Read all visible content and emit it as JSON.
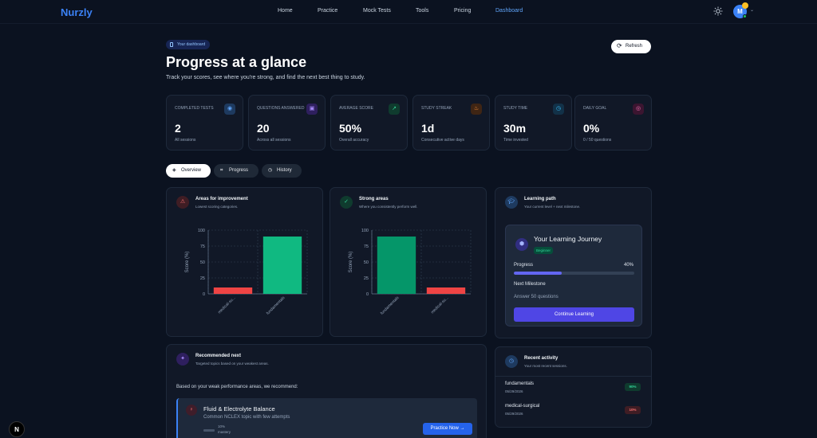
{
  "nav": {
    "logo": "Nurzly",
    "links": [
      "Home",
      "Practice",
      "Mock Tests",
      "Tools",
      "Pricing",
      "Dashboard"
    ],
    "active": "Dashboard",
    "avatar_initial": "M"
  },
  "header": {
    "pill": "Your dashboard",
    "title": "Progress at a glance",
    "subtitle": "Track your scores, see where you're strong, and find the next best thing to study.",
    "refresh_label": "Refresh"
  },
  "stats": [
    {
      "label": "COMPLETED TESTS",
      "value": "2",
      "sub": "All sessions",
      "icon": "eye-icon",
      "color": "#60a5fa",
      "bg": "#1e3a5f"
    },
    {
      "label": "QUESTIONS ANSWERED",
      "value": "20",
      "sub": "Across all sessions",
      "icon": "book-icon",
      "color": "#a78bfa",
      "bg": "#2e1f5e"
    },
    {
      "label": "AVERAGE SCORE",
      "value": "50%",
      "sub": "Overall accuracy",
      "icon": "trend-icon",
      "color": "#34d399",
      "bg": "#0f3b2e"
    },
    {
      "label": "STUDY STREAK",
      "value": "1d",
      "sub": "Consecutive active days",
      "icon": "flame-icon",
      "color": "#fb923c",
      "bg": "#3f2514"
    },
    {
      "label": "STUDY TIME",
      "value": "30m",
      "sub": "Time invested",
      "icon": "clock-icon",
      "color": "#38bdf8",
      "bg": "#123148"
    },
    {
      "label": "DAILY GOAL",
      "value": "0%",
      "sub": "0 / 50 questions",
      "icon": "target-icon",
      "color": "#f472b6",
      "bg": "#3b1530"
    }
  ],
  "tabs": [
    "Overview",
    "Progress",
    "History"
  ],
  "areas_improvement": {
    "title": "Areas for improvement",
    "subtitle": "Lowest scoring categories."
  },
  "strong_areas": {
    "title": "Strong areas",
    "subtitle": "Where you consistently perform well."
  },
  "learning_path": {
    "title": "Learning path",
    "subtitle": "Your current level + next milestone.",
    "journey_title": "Your Learning Journey",
    "badge": "Beginner",
    "progress_label": "Progress",
    "progress_value": "40%",
    "progress_fraction": 0.4,
    "milestone_label": "Next Milestone",
    "milestone_text": "Answer 50 questions",
    "button": "Continue Learning"
  },
  "recommended": {
    "title": "Recommended next",
    "subtitle": "Targeted topics based on your weakest areas.",
    "intro": "Based on your weak performance areas, we recommend:",
    "item_title": "Fluid & Electrolyte Balance",
    "item_sub": "Common NCLEX topic with few attempts",
    "item_pct": "10%",
    "item_mastery": "mastery",
    "button": "Practice Now →"
  },
  "activity": {
    "title": "Recent activity",
    "subtitle": "Your most recent sessions.",
    "items": [
      {
        "name": "fundamentals",
        "date": "05/29/2026",
        "score": "90%"
      },
      {
        "name": "medical-surgical",
        "date": "05/29/2026",
        "score": "10%"
      }
    ]
  },
  "chart_data": [
    {
      "type": "bar",
      "title": "Areas for improvement",
      "categories": [
        "medical-su...",
        "fundamentals"
      ],
      "values": [
        10,
        90
      ],
      "colors": [
        "#ef4444",
        "#10b981"
      ],
      "ylabel": "Score (%)",
      "ylim": [
        0,
        100
      ],
      "yticks": [
        0,
        25,
        50,
        75,
        100
      ],
      "grid": true
    },
    {
      "type": "bar",
      "title": "Strong areas",
      "categories": [
        "fundamentals",
        "medical-su..."
      ],
      "values": [
        90,
        10
      ],
      "colors": [
        "#059669",
        "#ef4444"
      ],
      "ylabel": "Score (%)",
      "ylim": [
        0,
        100
      ],
      "yticks": [
        0,
        25,
        50,
        75,
        100
      ],
      "grid": true
    }
  ]
}
